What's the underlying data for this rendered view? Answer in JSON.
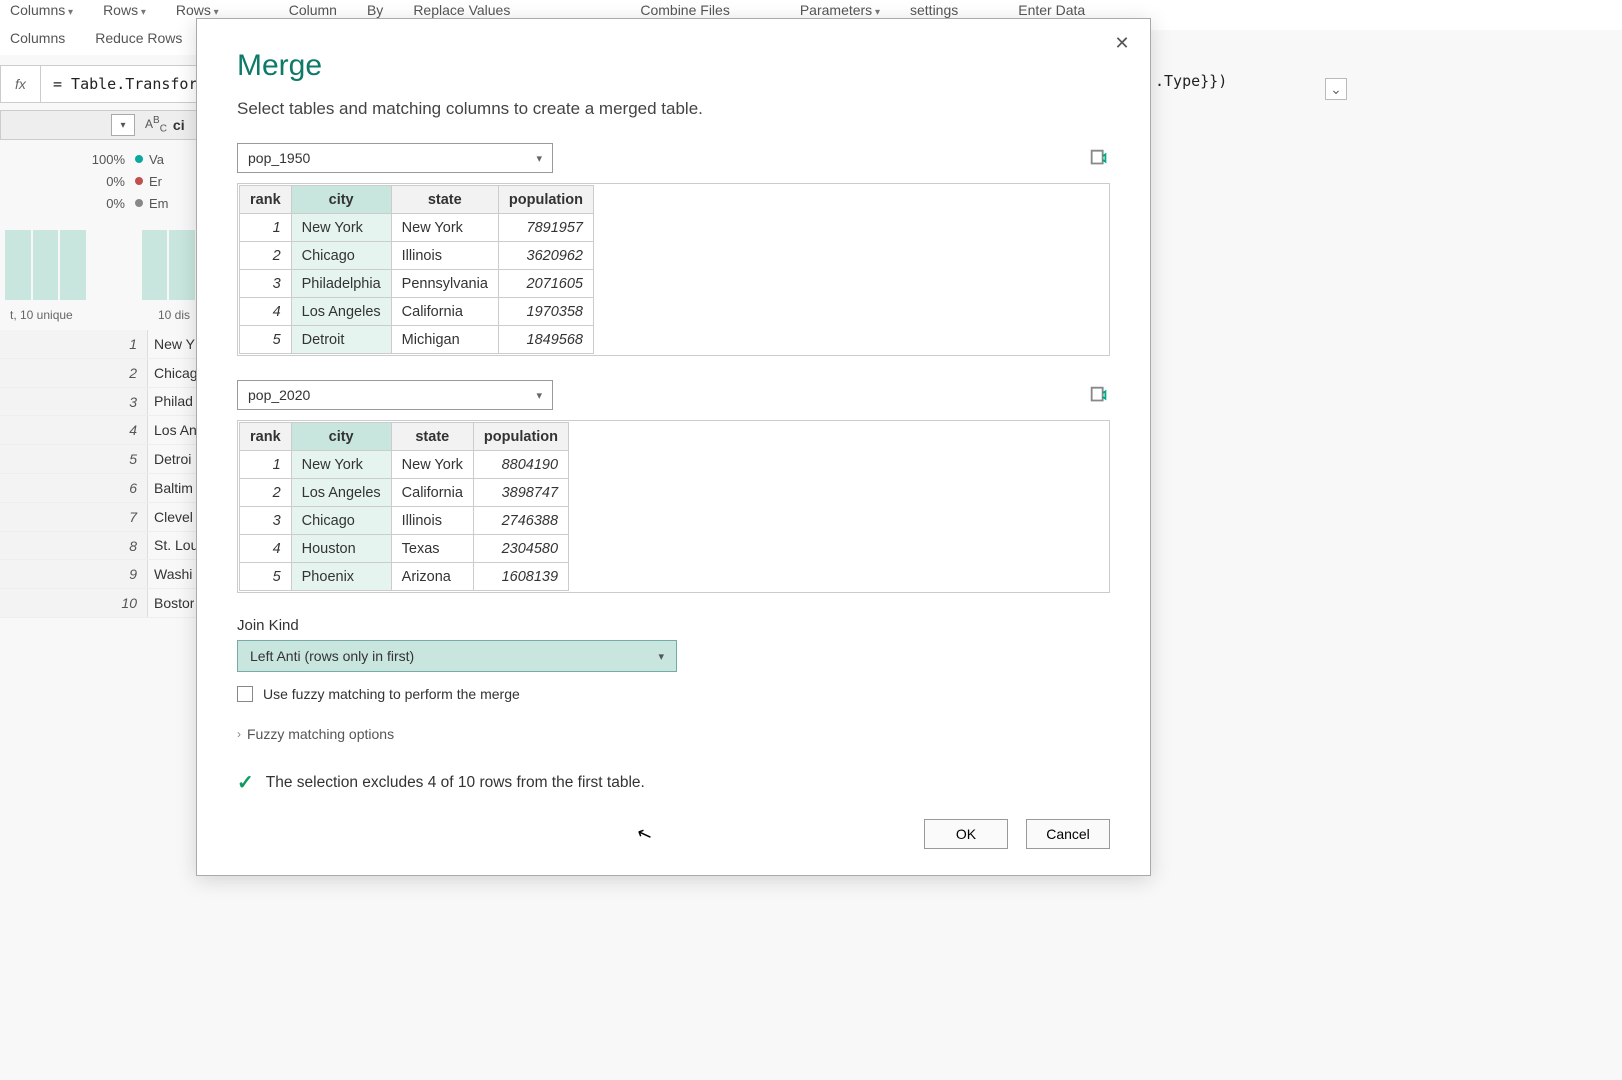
{
  "ribbon": {
    "items": [
      "Columns",
      "Rows",
      "Rows",
      "Column",
      "By",
      "Replace Values",
      "Combine Files",
      "Parameters",
      "settings",
      "Enter Data"
    ],
    "tabs": [
      "Columns",
      "Reduce Rows"
    ]
  },
  "formula": {
    "fx": "fx",
    "left": "= Table.Transfor",
    "right": ".Type}})"
  },
  "column_header": {
    "type_icon": "ABC",
    "partial": "ci"
  },
  "quality": {
    "rows": [
      {
        "pct": "100%",
        "label": "Va"
      },
      {
        "pct": "0%",
        "label": "Er"
      },
      {
        "pct": "0%",
        "label": "Em"
      }
    ],
    "dist_left": "t, 10 unique",
    "dist_right": "10 dis"
  },
  "background_cities": [
    {
      "idx": "1",
      "name": "New Y"
    },
    {
      "idx": "2",
      "name": "Chicag"
    },
    {
      "idx": "3",
      "name": "Philad"
    },
    {
      "idx": "4",
      "name": "Los An"
    },
    {
      "idx": "5",
      "name": "Detroi"
    },
    {
      "idx": "6",
      "name": "Baltim"
    },
    {
      "idx": "7",
      "name": "Clevel"
    },
    {
      "idx": "8",
      "name": "St. Lou"
    },
    {
      "idx": "9",
      "name": "Washi"
    },
    {
      "idx": "10",
      "name": "Bostor"
    }
  ],
  "dialog": {
    "title": "Merge",
    "subtitle": "Select tables and matching columns to create a merged table.",
    "table1": {
      "name": "pop_1950",
      "headers": [
        "rank",
        "city",
        "state",
        "population"
      ],
      "rows": [
        {
          "rank": "1",
          "city": "New York",
          "state": "New York",
          "population": "7891957"
        },
        {
          "rank": "2",
          "city": "Chicago",
          "state": "Illinois",
          "population": "3620962"
        },
        {
          "rank": "3",
          "city": "Philadelphia",
          "state": "Pennsylvania",
          "population": "2071605"
        },
        {
          "rank": "4",
          "city": "Los Angeles",
          "state": "California",
          "population": "1970358"
        },
        {
          "rank": "5",
          "city": "Detroit",
          "state": "Michigan",
          "population": "1849568"
        }
      ]
    },
    "table2": {
      "name": "pop_2020",
      "headers": [
        "rank",
        "city",
        "state",
        "population"
      ],
      "rows": [
        {
          "rank": "1",
          "city": "New York",
          "state": "New York",
          "population": "8804190"
        },
        {
          "rank": "2",
          "city": "Los Angeles",
          "state": "California",
          "population": "3898747"
        },
        {
          "rank": "3",
          "city": "Chicago",
          "state": "Illinois",
          "population": "2746388"
        },
        {
          "rank": "4",
          "city": "Houston",
          "state": "Texas",
          "population": "2304580"
        },
        {
          "rank": "5",
          "city": "Phoenix",
          "state": "Arizona",
          "population": "1608139"
        }
      ]
    },
    "join_kind_label": "Join Kind",
    "join_kind_value": "Left Anti (rows only in first)",
    "fuzzy_label": "Use fuzzy matching to perform the merge",
    "fuzzy_options_label": "Fuzzy matching options",
    "status_msg": "The selection excludes 4 of 10 rows from the first table.",
    "ok_label": "OK",
    "cancel_label": "Cancel"
  }
}
